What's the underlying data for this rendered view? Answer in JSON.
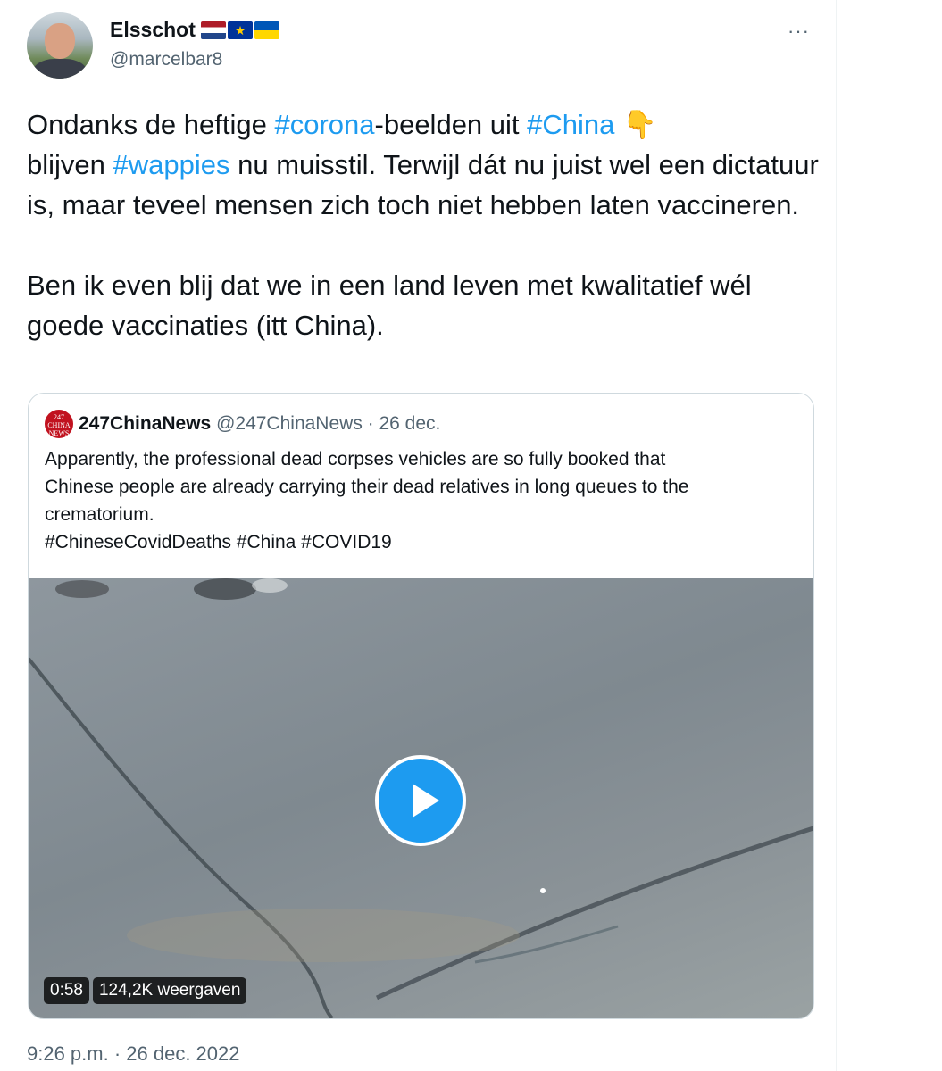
{
  "author": {
    "display_name": "Elsschot",
    "handle": "@marcelbar8",
    "flags": [
      "netherlands-flag",
      "eu-flag",
      "ukraine-flag"
    ],
    "more_label": "···"
  },
  "tweet": {
    "p1_a": "Ondanks de heftige ",
    "p1_tag1": "#corona",
    "p1_b": "-beelden uit ",
    "p1_tag2": "#China",
    "p1_emoji": "👇",
    "p1_c": "blijven ",
    "p1_tag3": "#wappies",
    "p1_d": " nu muisstil. Terwijl dát nu juist wel een dictatuur is, maar teveel mensen zich toch niet hebben laten vaccineren.",
    "p2": "Ben ik even blij dat we in een land leven met kwalitatief wél goede vaccinaties (itt China)."
  },
  "quote": {
    "avatar_text": "247 CHINA NEWS",
    "name": "247ChinaNews",
    "handle": "@247ChinaNews",
    "date": "· 26 dec.",
    "line1": "Apparently, the professional dead corpses vehicles are so fully booked that",
    "line2": "Chinese people are already carrying their dead relatives in long queues to the",
    "line3": "crematorium.",
    "line4": "#ChineseCovidDeaths #China #COVID19",
    "video": {
      "duration": "0:58",
      "views": "124,2K weergaven"
    }
  },
  "timestamp": "9:26 p.m. · 26 dec. 2022",
  "colors": {
    "link": "#1d9bf0",
    "secondary_text": "#536471",
    "border": "#cfd9de"
  }
}
